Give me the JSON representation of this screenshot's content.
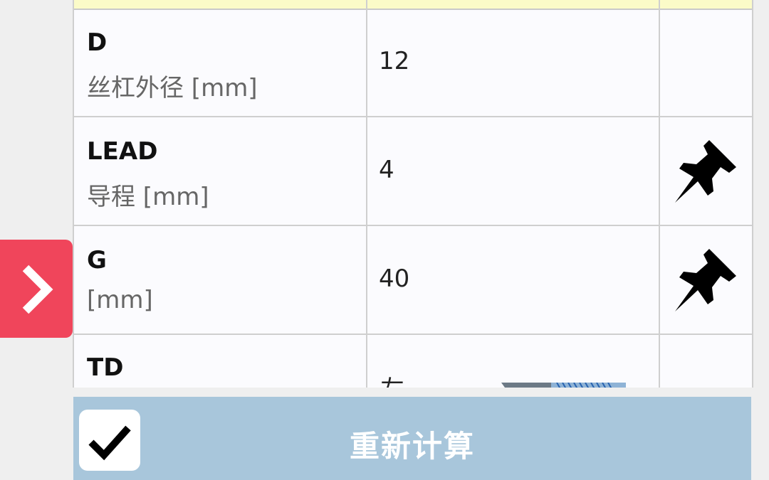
{
  "params": [
    {
      "name": "D",
      "desc": "丝杠外径 [mm]",
      "value": "12",
      "pinned": false
    },
    {
      "name": "LEAD",
      "desc": "导程 [mm]",
      "value": "4",
      "pinned": true
    },
    {
      "name": "G",
      "desc": "[mm]",
      "value": "40",
      "pinned": true
    },
    {
      "name": "TD",
      "desc": "",
      "value": "",
      "pinned": false
    }
  ],
  "partial_value_char": "左",
  "action": {
    "recalc_label": "重新计算"
  },
  "icons": {
    "pin": "pushpin-icon",
    "check": "checkmark-icon",
    "chevron": "chevron-right-icon"
  },
  "colors": {
    "toggle": "#f0455b",
    "action_bar": "#a8c6db",
    "header_strip": "#fbfbc8"
  }
}
